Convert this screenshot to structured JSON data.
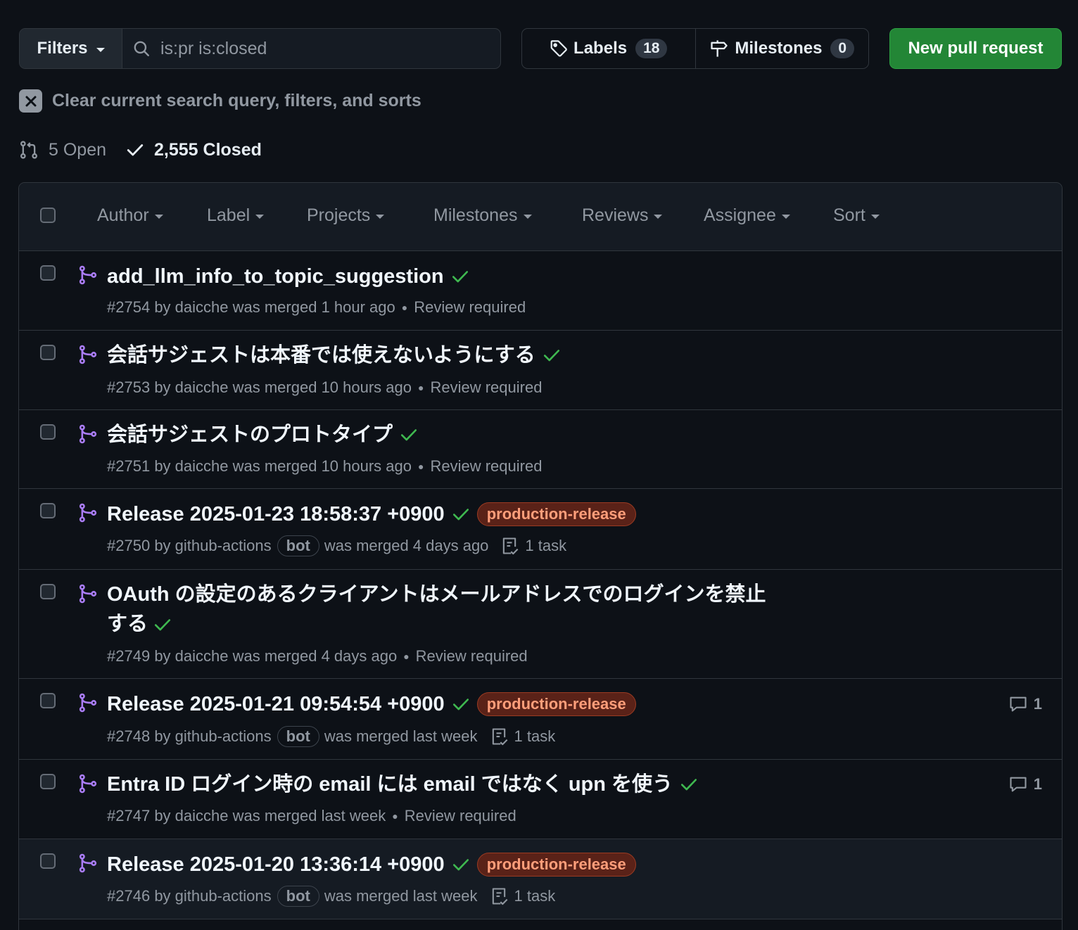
{
  "toolbar": {
    "filters_label": "Filters",
    "search_value": "is:pr is:closed",
    "labels_label": "Labels",
    "labels_count": "18",
    "milestones_label": "Milestones",
    "milestones_count": "0",
    "new_pr_label": "New pull request"
  },
  "clear_text": "Clear current search query, filters, and sorts",
  "states": {
    "open": "5 Open",
    "closed": "2,555 Closed"
  },
  "header_filters": [
    "Author",
    "Label",
    "Projects",
    "Milestones",
    "Reviews",
    "Assignee",
    "Sort"
  ],
  "colors": {
    "accent_green": "#238636",
    "merged_purple": "#ab7df8",
    "check_green": "#3fb950",
    "label_bg": "#5a2218",
    "label_text": "#ff9e7a"
  },
  "pull_requests": [
    {
      "title": "add_llm_info_to_topic_suggestion",
      "number": "#2754",
      "by": "by daicche was merged",
      "time": "1 hour ago",
      "status": "Review required"
    },
    {
      "title": "会話サジェストは本番では使えないようにする",
      "number": "#2753",
      "by": "by daicche was merged",
      "time": "10 hours ago",
      "status": "Review required"
    },
    {
      "title": "会話サジェストのプロトタイプ",
      "number": "#2751",
      "by": "by daicche was merged",
      "time": "10 hours ago",
      "status": "Review required"
    },
    {
      "title": "Release 2025-01-23 18:58:37 +0900",
      "label": "production-release",
      "number": "#2750",
      "by": "by github-actions",
      "bot": "bot",
      "merged": "was merged 4 days ago",
      "tasks": "1 task"
    },
    {
      "title": "OAuth の設定のあるクライアントはメールアドレスでのログインを禁止する",
      "number": "#2749",
      "by": "by daicche was merged",
      "time": "4 days ago",
      "status": "Review required"
    },
    {
      "title": "Release 2025-01-21 09:54:54 +0900",
      "label": "production-release",
      "number": "#2748",
      "by": "by github-actions",
      "bot": "bot",
      "merged": "was merged last week",
      "tasks": "1 task",
      "comments": "1"
    },
    {
      "title": "Entra ID ログイン時の email には email ではなく upn を使う",
      "number": "#2747",
      "by": "by daicche was merged",
      "time": "last week",
      "status": "Review required",
      "comments": "1"
    },
    {
      "title": "Release 2025-01-20 13:36:14 +0900",
      "label": "production-release",
      "number": "#2746",
      "by": "by github-actions",
      "bot": "bot",
      "merged": "was merged last week",
      "tasks": "1 task"
    }
  ]
}
